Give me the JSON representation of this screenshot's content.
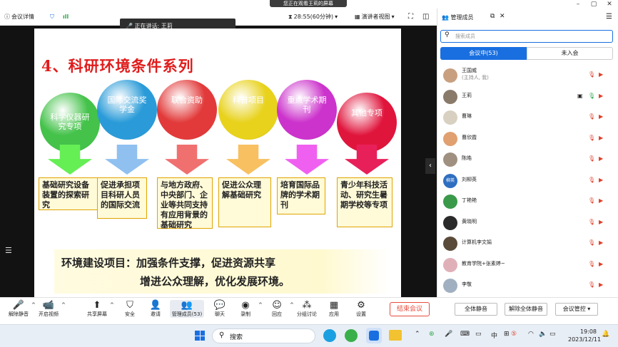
{
  "screen_share": {
    "banner": "您正在观看王莉的屏幕",
    "speaking_prefix": "正在讲话:",
    "speaker": "王莉"
  },
  "topbar": {
    "meeting_info": "会议详情",
    "timer": "28:55(60分钟)",
    "view_mode": "演讲者视图"
  },
  "slide": {
    "title": "4、科研环境条件系列",
    "balls": [
      {
        "label": "科学仪器研究专项",
        "color": "#44c24a"
      },
      {
        "label": "国际交流奖学金",
        "color": "#2a9bd8"
      },
      {
        "label": "联合资助",
        "color": "#e23a3a"
      },
      {
        "label": "科普项目",
        "color": "#e8d21c"
      },
      {
        "label": "重点学术期刊",
        "color": "#cc33cc"
      },
      {
        "label": "其他专项",
        "color": "#e0153c"
      }
    ],
    "boxes": [
      "基础研究设备装置的探索研究",
      "促进承担项目科研人员的国际交流",
      "与地方政府、中央部门、企业等共同支持有应用背景的基础研究",
      "促进公众理解基础研究",
      "培育国际品牌的学术期刊",
      "青少年科技活动、研究生暑期学校等专项"
    ],
    "arrow_colors": [
      "#66ee55",
      "#8fc0f0",
      "#f07070",
      "#f8c060",
      "#f060f0",
      "#e8205a"
    ],
    "line1": "环境建设项目：加强条件支撑，促进资源共享",
    "line2": "增进公众理解，优化发展环境。"
  },
  "sidebar": {
    "title": "管理成员",
    "search_placeholder": "搜索成员",
    "tab_in_meeting": "会议中(53)",
    "tab_not_joined": "未入会",
    "members": [
      {
        "name": "王国威",
        "sub": "(主持人, 我)",
        "avatar": "#c8a080"
      },
      {
        "name": "王莉",
        "sub": "",
        "avatar": "#8a7a6a"
      },
      {
        "name": "曹琳",
        "sub": "",
        "avatar": "#d8d0c0"
      },
      {
        "name": "曹欣霞",
        "sub": "",
        "avatar": "#e0a070"
      },
      {
        "name": "陈皓",
        "sub": "",
        "avatar": "#a09080"
      },
      {
        "name": "刘柳英",
        "sub": "",
        "avatar": "#2f6fc0",
        "initials": "柳英"
      },
      {
        "name": "丁艳艳",
        "sub": "",
        "avatar": "#3a9a4a"
      },
      {
        "name": "黄晓明",
        "sub": "",
        "avatar": "#2a2a2a"
      },
      {
        "name": "计算机李文娟",
        "sub": "",
        "avatar": "#5a4a3a"
      },
      {
        "name": "教育学院+张素婷~",
        "sub": "",
        "avatar": "#e0b0b8"
      },
      {
        "name": "李敬",
        "sub": "",
        "avatar": "#a0b0c0"
      }
    ],
    "mute_all": "全体静音",
    "unmute_all": "解除全体静音",
    "meeting_control": "会议管控"
  },
  "toolbar": {
    "items": [
      "解除静音",
      "开启视频",
      "共享屏幕",
      "安全",
      "邀请",
      "管理成员(53)",
      "聊天",
      "录制",
      "回应",
      "分组讨论",
      "应用",
      "设置"
    ],
    "end_meeting": "结束会议"
  },
  "taskbar": {
    "search": "搜索",
    "ime": "中",
    "time": "19:08",
    "date": "2023/12/11"
  }
}
